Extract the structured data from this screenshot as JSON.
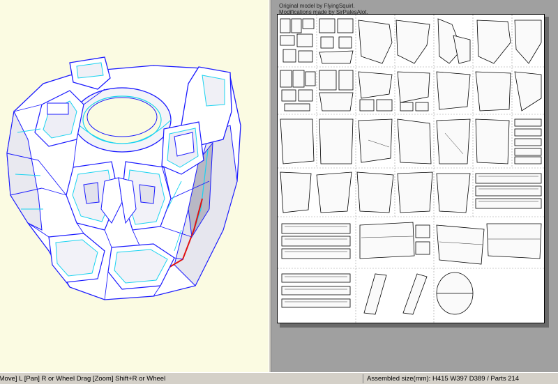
{
  "sheet": {
    "credit_line_1": "Original model by FlyingSquirl.",
    "credit_line_2": "Modifications made by SirPalesAlot."
  },
  "status": {
    "left_text": "[Move] L [Pan] R or Wheel Drag [Zoom] Shift+R or Wheel",
    "right_text": "Assembled size(mm): H415 W397 D389 / Parts 214"
  },
  "colors": {
    "viewport_background": "#fbfbe2",
    "model_edge": "#1a1aff",
    "fold_edge": "#19d3f0",
    "seam_edge": "#e01010",
    "sheet_background": "#ffffff",
    "workspace_background": "#a0a0a0"
  },
  "icons": {
    "model": "armor-chest-wireframe",
    "sheet": "unfolded-parts-layout"
  }
}
